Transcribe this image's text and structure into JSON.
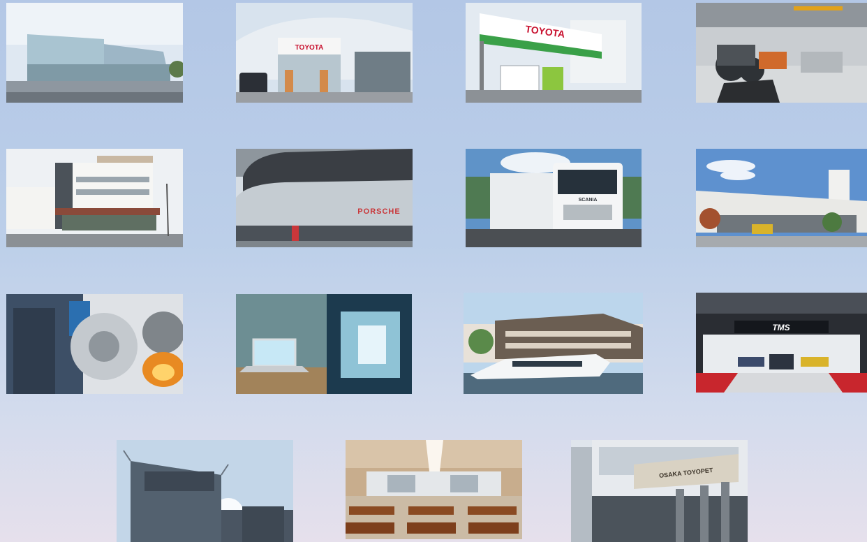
{
  "photos": {
    "toyota_store_sign": "TOYOTA",
    "toyota_canopy_sign": "TOYOTA",
    "porsche_sign": "PORSCHE",
    "scania_sign": "SCANIA",
    "tms_sign": "TMS",
    "osaka_toyopet_sign": "OSAKA TOYOPET"
  }
}
